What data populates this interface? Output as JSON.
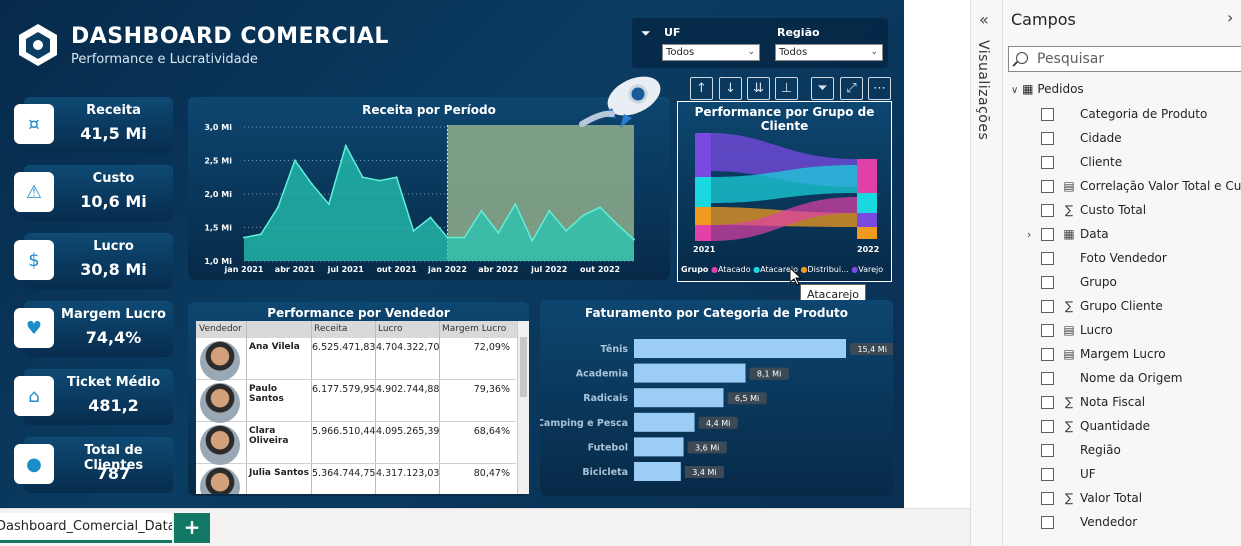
{
  "header": {
    "title": "DASHBOARD COMERCIAL",
    "subtitle": "Performance e Lucratividade"
  },
  "slicers": {
    "uf_label": "UF",
    "uf_value": "Todos",
    "regiao_label": "Região",
    "regiao_value": "Todos"
  },
  "kpis": [
    {
      "label": "Receita",
      "value": "41,5 Mi",
      "icon": "coins-icon"
    },
    {
      "label": "Custo",
      "value": "10,6 Mi",
      "icon": "warning-chart-icon"
    },
    {
      "label": "Lucro",
      "value": "30,8 Mi",
      "icon": "money-hand-icon"
    },
    {
      "label": "Margem Lucro",
      "value": "74,4%",
      "icon": "heart-card-icon"
    },
    {
      "label": "Ticket Médio",
      "value": "481,2",
      "icon": "price-tag-icon"
    },
    {
      "label": "Total de Clientes",
      "value": "787",
      "icon": "person-icon"
    }
  ],
  "revenue_chart": {
    "title": "Receita por Período",
    "y_ticks": [
      "3,0 Mi",
      "2,5 Mi",
      "2,0 Mi",
      "1,5 Mi",
      "1,0 Mi"
    ],
    "x_ticks": [
      "jan 2021",
      "abr 2021",
      "jul 2021",
      "out 2021",
      "jan 2022",
      "abr 2022",
      "jul 2022",
      "out 2022"
    ]
  },
  "chart_data": [
    {
      "type": "area",
      "title": "Receita por Período",
      "x": [
        "jan 2021",
        "fev 2021",
        "mar 2021",
        "abr 2021",
        "mai 2021",
        "jun 2021",
        "jul 2021",
        "ago 2021",
        "set 2021",
        "out 2021",
        "nov 2021",
        "dez 2021",
        "jan 2022",
        "fev 2022",
        "mar 2022",
        "abr 2022",
        "mai 2022",
        "jun 2022",
        "jul 2022",
        "ago 2022",
        "set 2022",
        "out 2022",
        "nov 2022",
        "dez 2022"
      ],
      "values": [
        1.35,
        1.4,
        1.8,
        2.5,
        2.15,
        1.85,
        2.72,
        2.25,
        2.2,
        2.25,
        1.45,
        1.65,
        1.35,
        1.35,
        1.75,
        1.42,
        1.85,
        1.3,
        1.75,
        1.45,
        1.68,
        1.8,
        1.55,
        1.32
      ],
      "ylim": [
        1.0,
        3.0
      ],
      "highlight_from": "jan 2022"
    },
    {
      "type": "bar",
      "title": "Faturamento por Categoria de Produto",
      "categories": [
        "Tênis",
        "Academia",
        "Radicais",
        "Camping e Pesca",
        "Futebol",
        "Bicicleta"
      ],
      "values": [
        15.4,
        8.1,
        6.5,
        4.4,
        3.6,
        3.4
      ],
      "data_labels": [
        "15,4 Mi",
        "8,1 Mi",
        "6,5 Mi",
        "4,4 Mi",
        "3,6 Mi",
        "3,4 Mi"
      ]
    }
  ],
  "sankey": {
    "title": "Performance por Grupo de Cliente",
    "left_label": "2021",
    "right_label": "2022",
    "legend_title": "Grupo",
    "legend": [
      {
        "name": "Atacado",
        "color": "#e040a8"
      },
      {
        "name": "Atacarejo",
        "color": "#19d8e0"
      },
      {
        "name": "Distribui...",
        "color": "#f09a20"
      },
      {
        "name": "Varejo",
        "color": "#7a4ae0"
      }
    ]
  },
  "tooltip": {
    "text": "Atacarejo"
  },
  "vendors": {
    "title": "Performance por Vendedor",
    "headers": [
      "Vendedor",
      "Receita",
      "Lucro",
      "Margem Lucro"
    ],
    "rows": [
      {
        "name": "Ana Vilela",
        "receita": "6.525.471,83",
        "lucro": "4.704.322,70",
        "margem": "72,09%"
      },
      {
        "name": "Paulo Santos",
        "receita": "6.177.579,95",
        "lucro": "4.902.744,88",
        "margem": "79,36%"
      },
      {
        "name": "Clara Oliveira",
        "receita": "5.966.510,44",
        "lucro": "4.095.265,39",
        "margem": "68,64%"
      },
      {
        "name": "Julia Santos",
        "receita": "5.364.744,75",
        "lucro": "4.317.123,03",
        "margem": "80,47%"
      }
    ]
  },
  "categories_chart": {
    "title": "Faturamento por Categoria de Produto"
  },
  "pages": {
    "current": "Dashboard_Comercial_DataB",
    "add": "+"
  },
  "vis_panel": {
    "title": "Visualizações",
    "collapse": "«"
  },
  "fields_panel": {
    "title": "Campos",
    "close": "›",
    "search_placeholder": "Pesquisar",
    "table": "Pedidos",
    "fields": [
      {
        "name": "Categoria de Produto",
        "icon": ""
      },
      {
        "name": "Cidade",
        "icon": ""
      },
      {
        "name": "Cliente",
        "icon": ""
      },
      {
        "name": "Correlação Valor Total e Custo...",
        "icon": "calculator-icon"
      },
      {
        "name": "Custo Total",
        "icon": "sigma-icon"
      },
      {
        "name": "Data",
        "icon": "calendar-icon"
      },
      {
        "name": "Foto Vendedor",
        "icon": ""
      },
      {
        "name": "Grupo",
        "icon": ""
      },
      {
        "name": "Grupo Cliente",
        "icon": "sigma-icon"
      },
      {
        "name": "Lucro",
        "icon": "calculator-icon"
      },
      {
        "name": "Margem Lucro",
        "icon": "calculator-icon"
      },
      {
        "name": "Nome da Origem",
        "icon": ""
      },
      {
        "name": "Nota Fiscal",
        "icon": "sigma-icon"
      },
      {
        "name": "Quantidade",
        "icon": "sigma-icon"
      },
      {
        "name": "Região",
        "icon": ""
      },
      {
        "name": "UF",
        "icon": ""
      },
      {
        "name": "Valor Total",
        "icon": "sigma-icon"
      },
      {
        "name": "Vendedor",
        "icon": ""
      }
    ]
  }
}
